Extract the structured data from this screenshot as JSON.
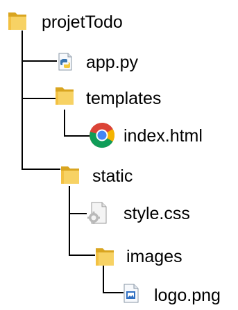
{
  "colors": {
    "folder": "#f3c143",
    "folder_dark": "#d9a520",
    "connector": "#000000",
    "python_blue": "#3a76b0",
    "python_yellow": "#f4c93c",
    "chrome_red": "#db4437",
    "chrome_yellow": "#f4b400",
    "chrome_green": "#0f9d58",
    "chrome_blue": "#4285f4"
  },
  "tree": {
    "root": {
      "label": "projetTodo",
      "icon": "folder-icon"
    },
    "app_py": {
      "label": "app.py",
      "icon": "python-file-icon"
    },
    "templates": {
      "label": "templates",
      "icon": "folder-icon"
    },
    "index_html": {
      "label": "index.html",
      "icon": "chrome-icon"
    },
    "static": {
      "label": "static",
      "icon": "folder-icon"
    },
    "style_css": {
      "label": "style.css",
      "icon": "css-file-icon"
    },
    "images": {
      "label": "images",
      "icon": "folder-icon"
    },
    "logo_png": {
      "label": "logo.png",
      "icon": "image-file-icon"
    }
  }
}
